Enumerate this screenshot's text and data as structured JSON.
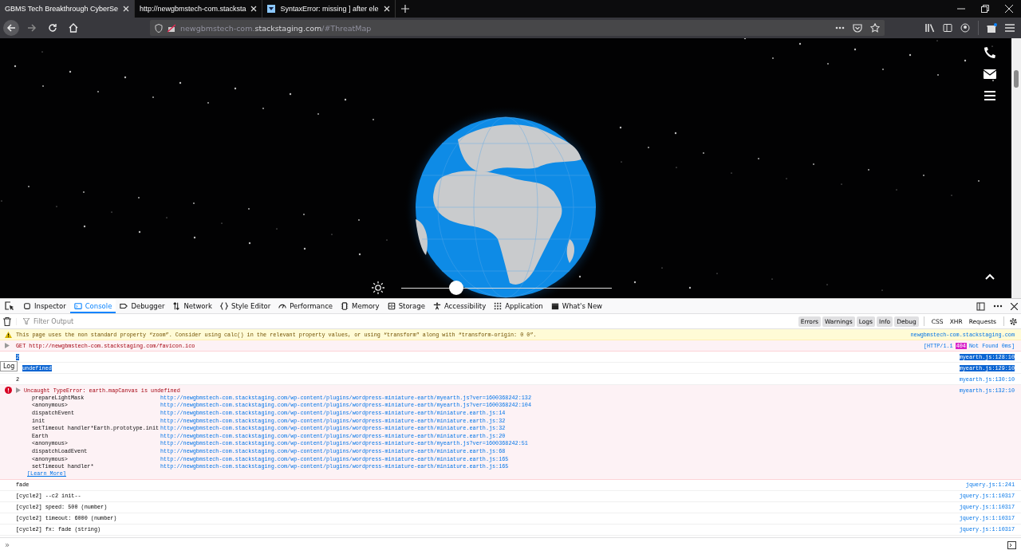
{
  "browser_tabs": [
    {
      "title": "GBMS Tech Breakthrough CyberSe",
      "selected": true
    },
    {
      "title": "http://newgbmstech-com.stacksta",
      "selected": false
    },
    {
      "title": "SyntaxError: missing ] after ele",
      "selected": false
    }
  ],
  "address_bar": {
    "host_prefix": "newgbmstech-com.",
    "domain": "stackstaging.com",
    "path": "/#ThreatMap"
  },
  "page": {
    "brightness_slider": {
      "level": 0.26
    }
  },
  "devtools": {
    "tools": [
      {
        "label": "Inspector",
        "selected": false
      },
      {
        "label": "Console",
        "selected": true
      },
      {
        "label": "Debugger",
        "selected": false
      },
      {
        "label": "Network",
        "selected": false
      },
      {
        "label": "Style Editor",
        "selected": false
      },
      {
        "label": "Performance",
        "selected": false
      },
      {
        "label": "Memory",
        "selected": false
      },
      {
        "label": "Storage",
        "selected": false
      },
      {
        "label": "Accessibility",
        "selected": false
      },
      {
        "label": "Application",
        "selected": false
      },
      {
        "label": "What's New",
        "selected": false
      }
    ],
    "filter": {
      "placeholder": "Filter Output"
    },
    "level_filters": [
      {
        "label": "Errors",
        "selected": true
      },
      {
        "label": "Warnings",
        "selected": true
      },
      {
        "label": "Logs",
        "selected": true
      },
      {
        "label": "Info",
        "selected": true
      },
      {
        "label": "Debug",
        "selected": true
      }
    ],
    "type_filters": [
      {
        "label": "CSS",
        "selected": false
      },
      {
        "label": "XHR",
        "selected": false
      },
      {
        "label": "Requests",
        "selected": false
      }
    ],
    "messages": [
      {
        "kind": "warning",
        "text": "This page uses the non standard property “zoom”. Consider using calc() in the relevant property values, or using “transform” along with “transform-origin: 0 0”.",
        "source": "newgbmstech-com.stackstaging.com"
      },
      {
        "kind": "network",
        "text": "GET http://newgbmstech-com.stackstaging.com/favicon.ico",
        "status_prefix": "[HTTP/1.1",
        "status_code": "404",
        "status_suffix": "Not Found 0ms]"
      },
      {
        "kind": "log",
        "text": "2",
        "source": "myearth.js:128:10",
        "selected": true
      },
      {
        "kind": "log",
        "text": "undefined",
        "source": "myearth.js:129:10",
        "selected": true,
        "tooltip": "Log"
      },
      {
        "kind": "log",
        "text": "2",
        "source": "myearth.js:130:10",
        "selected": false
      },
      {
        "kind": "error",
        "text": "Uncaught TypeError: earth.mapCanvas is undefined",
        "source": "myearth.js:132:10",
        "learn_more": "[Learn More]",
        "frames": [
          {
            "function": "prepareLightMask",
            "url": "http://newgbmstech-com.stackstaging.com/wp-content/plugins/wordpress-miniature-earth/myearth.js?ver=1600368242:132"
          },
          {
            "function": "<anonymous>",
            "url": "http://newgbmstech-com.stackstaging.com/wp-content/plugins/wordpress-miniature-earth/myearth.js?ver=1600368242:104"
          },
          {
            "function": "dispatchEvent",
            "url": "http://newgbmstech-com.stackstaging.com/wp-content/plugins/wordpress-miniature-earth/miniature.earth.js:14"
          },
          {
            "function": "init",
            "url": "http://newgbmstech-com.stackstaging.com/wp-content/plugins/wordpress-miniature-earth/miniature.earth.js:32"
          },
          {
            "function": "setTimeout handler*Earth.prototype.init",
            "url": "http://newgbmstech-com.stackstaging.com/wp-content/plugins/wordpress-miniature-earth/miniature.earth.js:32"
          },
          {
            "function": "Earth",
            "url": "http://newgbmstech-com.stackstaging.com/wp-content/plugins/wordpress-miniature-earth/miniature.earth.js:20"
          },
          {
            "function": "<anonymous>",
            "url": "http://newgbmstech-com.stackstaging.com/wp-content/plugins/wordpress-miniature-earth/myearth.js?ver=1600368242:51"
          },
          {
            "function": "dispatchLoadEvent",
            "url": "http://newgbmstech-com.stackstaging.com/wp-content/plugins/wordpress-miniature-earth/miniature.earth.js:68"
          },
          {
            "function": "<anonymous>",
            "url": "http://newgbmstech-com.stackstaging.com/wp-content/plugins/wordpress-miniature-earth/miniature.earth.js:165"
          },
          {
            "function": "setTimeout handler*",
            "url": "http://newgbmstech-com.stackstaging.com/wp-content/plugins/wordpress-miniature-earth/miniature.earth.js:165"
          }
        ]
      },
      {
        "kind": "log",
        "text": "fade",
        "source": "jquery.js:1:241",
        "selected": false
      },
      {
        "kind": "log",
        "text": "[cycle2] --c2 init--",
        "source": "jquery.js:1:10317",
        "selected": false
      },
      {
        "kind": "log",
        "text": "[cycle2] speed: 500 (number)",
        "source": "jquery.js:1:10317",
        "selected": false
      },
      {
        "kind": "log",
        "text": "[cycle2] timeout: 6000 (number)",
        "source": "jquery.js:1:10317",
        "selected": false
      },
      {
        "kind": "log",
        "text": "[cycle2] fx: fade (string)",
        "source": "jquery.js:1:10317",
        "selected": false
      }
    ],
    "prompt": "»"
  }
}
